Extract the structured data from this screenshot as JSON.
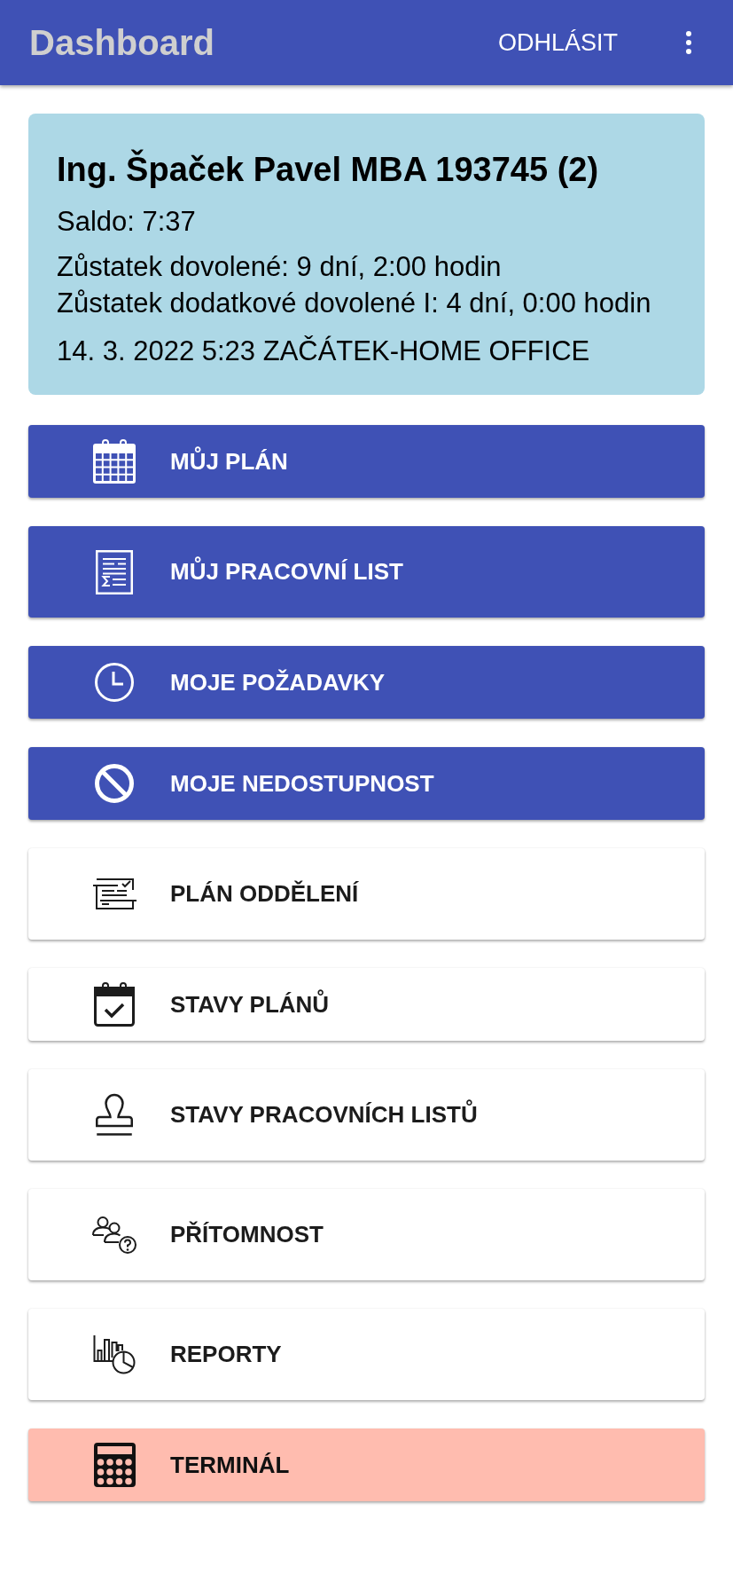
{
  "header": {
    "title": "Dashboard",
    "logout_label": "ODHLÁSIT"
  },
  "profile": {
    "name": "Ing. Špaček Pavel MBA 193745 (2)",
    "balance": "Saldo: 7:37",
    "leave_lines": [
      "Zůstatek dovolené: 9 dní, 2:00 hodin",
      "Zůstatek dodatkové dovolené I: 4 dní, 0:00 hodin"
    ],
    "last_event": "14. 3. 2022 5:23 ZAČÁTEK-HOME OFFICE"
  },
  "menu": [
    {
      "label": "MŮJ PLÁN",
      "kind": "primary"
    },
    {
      "label": "MŮJ PRACOVNÍ LIST",
      "kind": "primary"
    },
    {
      "label": "MOJE POŽADAVKY",
      "kind": "primary"
    },
    {
      "label": "MOJE NEDOSTUPNOST",
      "kind": "primary"
    },
    {
      "label": "PLÁN ODDĚLENÍ",
      "kind": "plain"
    },
    {
      "label": "STAVY PLÁNŮ",
      "kind": "plain"
    },
    {
      "label": "STAVY PRACOVNÍCH LISTŮ",
      "kind": "plain"
    },
    {
      "label": "PŘÍTOMNOST",
      "kind": "plain"
    },
    {
      "label": "REPORTY",
      "kind": "plain"
    },
    {
      "label": "TERMINÁL",
      "kind": "alert"
    }
  ]
}
